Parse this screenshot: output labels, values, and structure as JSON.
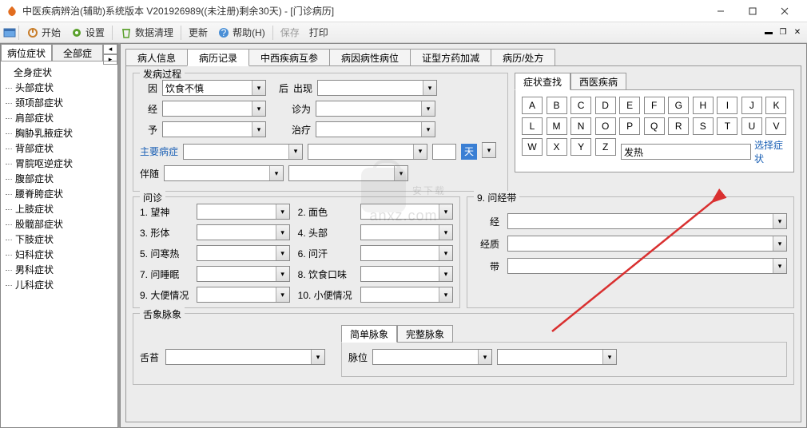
{
  "window": {
    "title": "中医疾病辨治(辅助)系统版本 V201926989((未注册)剩余30天) - [门诊病历]"
  },
  "menu": {
    "start": "开始",
    "settings": "设置",
    "cleanup": "数据清理",
    "update": "更新",
    "help": "帮助(H)",
    "save": "保存",
    "print": "打印"
  },
  "sidebar": {
    "tab1": "病位症状",
    "tab2": "全部症",
    "items": [
      "全身症状",
      "头部症状",
      "颈项部症状",
      "肩部症状",
      "胸胁乳腋症状",
      "背部症状",
      "胃脘呕逆症状",
      "腹部症状",
      "腰脊胯症状",
      "上肢症状",
      "股髋部症状",
      "下肢症状",
      "妇科症状",
      "男科症状",
      "儿科症状"
    ]
  },
  "tabs": [
    "病人信息",
    "病历记录",
    "中西疾病互参",
    "病因病性病位",
    "证型方药加减",
    "病历/处方"
  ],
  "onset": {
    "title": "发病过程",
    "cause_lbl": "因",
    "cause_val": "饮食不慎",
    "after_lbl": "后",
    "appear_lbl": "出现",
    "via_lbl": "经",
    "diag_lbl": "诊为",
    "give_lbl": "予",
    "treat_lbl": "治疗",
    "main_lbl": "主要病症",
    "tian": "天",
    "accompany_lbl": "伴随"
  },
  "symsearch": {
    "tab1": "症状查找",
    "tab2": "西医疾病",
    "letters": [
      "A",
      "B",
      "C",
      "D",
      "E",
      "F",
      "G",
      "H",
      "I",
      "J",
      "K",
      "L",
      "M",
      "N",
      "O",
      "P",
      "Q",
      "R",
      "S",
      "T",
      "U",
      "V",
      "W",
      "X",
      "Y",
      "Z"
    ],
    "input_val": "发热",
    "select_link": "选择症状"
  },
  "inquiry": {
    "title": "问诊",
    "q1": "1. 望神",
    "q2": "2. 面色",
    "q3": "3. 形体",
    "q4": "4. 头部",
    "q5": "5. 问寒热",
    "q6": "6. 问汗",
    "q7": "7. 问睡眠",
    "q8": "8. 饮食口味",
    "q9": "9. 大便情况",
    "q10": "10. 小便情况"
  },
  "menses": {
    "title": "9. 问经带",
    "jing": "经",
    "jingzhi": "经质",
    "dai": "带"
  },
  "tongue": {
    "title": "舌象脉象",
    "tai": "舌苔",
    "p_tab1": "简单脉象",
    "p_tab2": "完整脉象",
    "pos": "脉位"
  },
  "watermark": {
    "t1": "安下载",
    "t2": "anxz.com"
  }
}
